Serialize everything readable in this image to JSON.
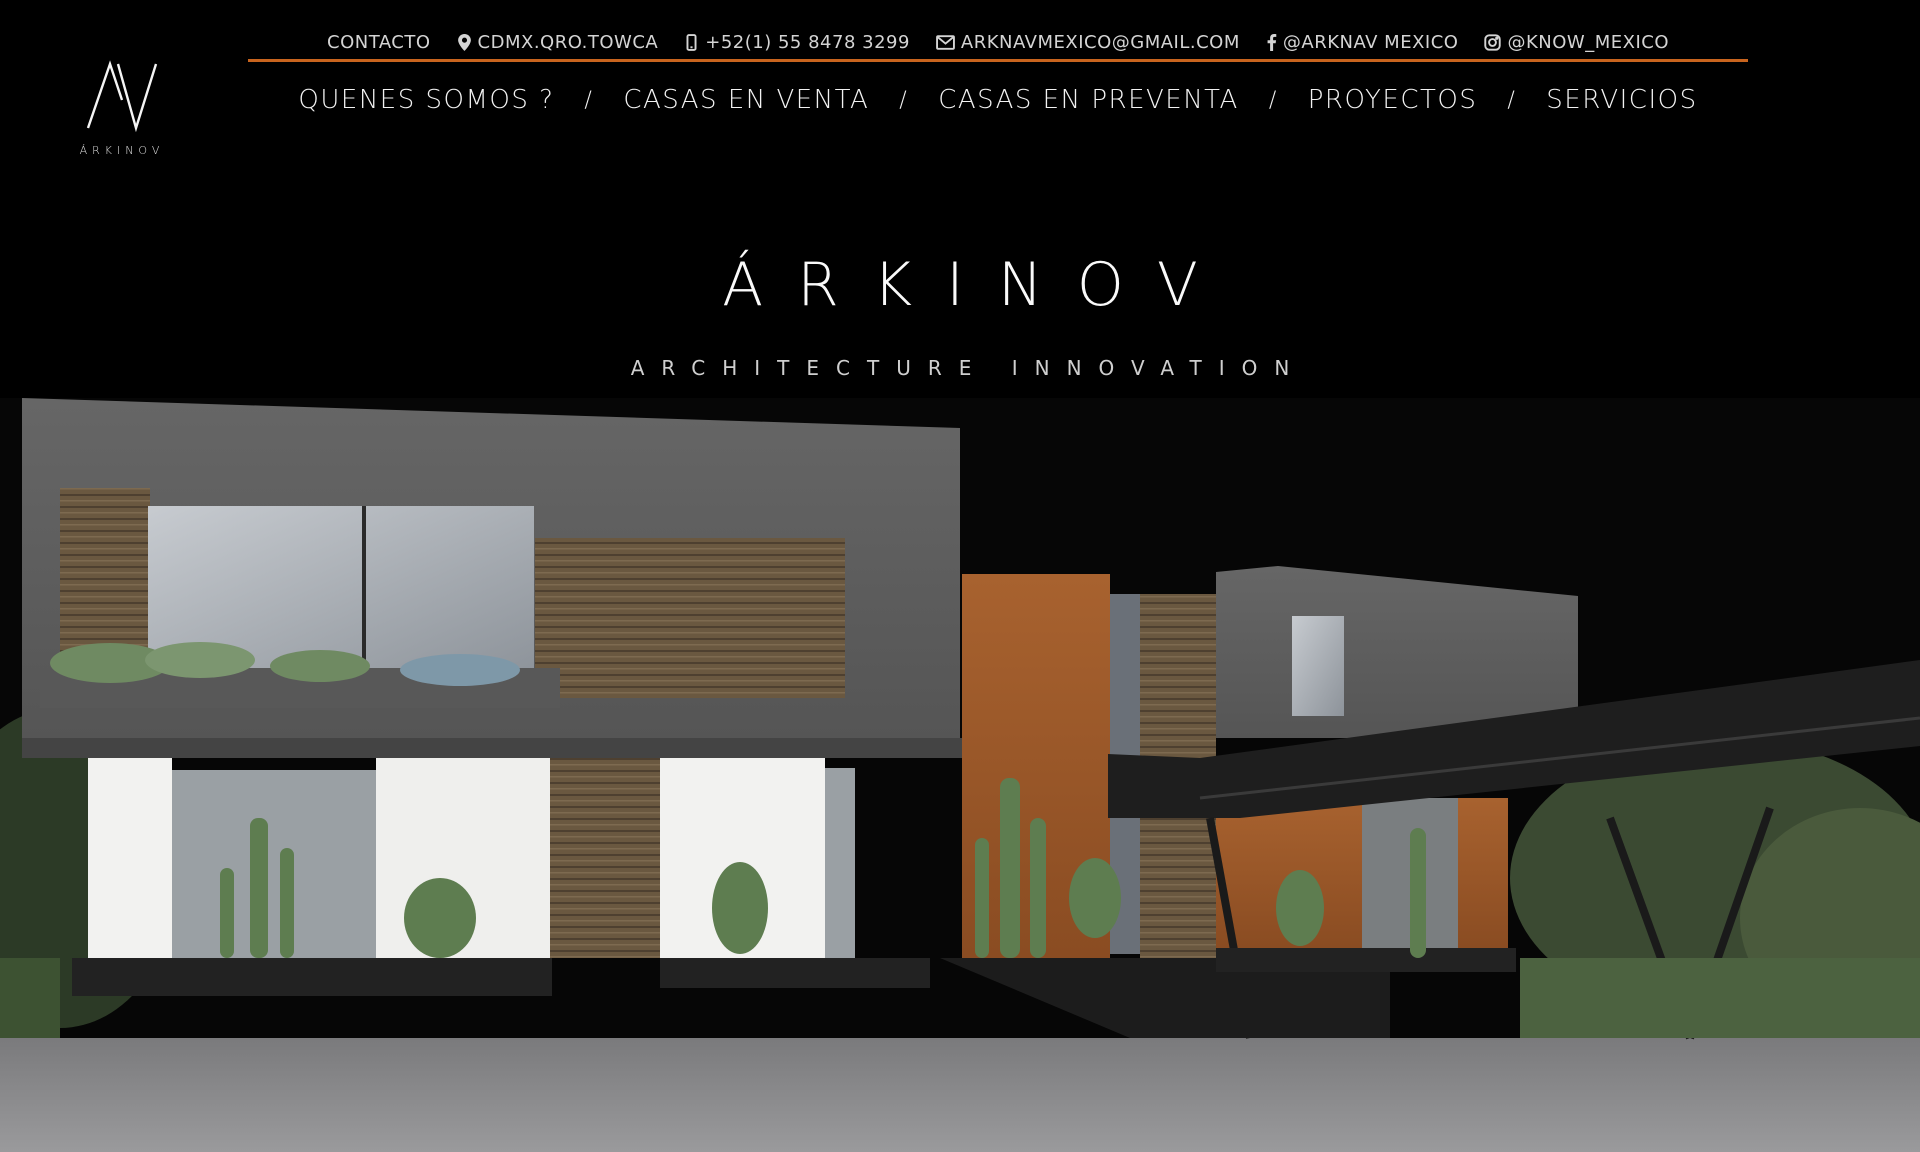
{
  "brand": {
    "logo_mark": "AV",
    "logo_word": "ÁRKINOV",
    "title": "ÁRKINOV",
    "tagline": "ARCHITECTURE INNOVATION"
  },
  "topbar": {
    "contact_label": "CONTACTO",
    "location": "CDMX.QRO.TOWCA",
    "phone": "+52(1) 55 8478 3299",
    "email": "ARKNAVMEXICO@GMAIL.COM",
    "facebook": "@ARKNAV MEXICO",
    "instagram": "@KNOW_MEXICO",
    "icons": {
      "location": "map-pin-icon",
      "phone": "mobile-phone-icon",
      "email": "envelope-icon",
      "facebook": "facebook-icon",
      "instagram": "instagram-icon"
    }
  },
  "nav": {
    "items": [
      {
        "label": "QUENES SOMOS ?"
      },
      {
        "label": "CASAS EN VENTA"
      },
      {
        "label": "CASAS EN PREVENTA"
      },
      {
        "label": "PROYECTOS"
      },
      {
        "label": "SERVICIOS"
      }
    ],
    "separator": "/"
  },
  "colors": {
    "background": "#000000",
    "accent": "#c8641e",
    "text": "#f2f2f2",
    "concrete": "#5c5c5c",
    "wood": "#6b5a44",
    "rust_wall": "#a85c2c"
  }
}
